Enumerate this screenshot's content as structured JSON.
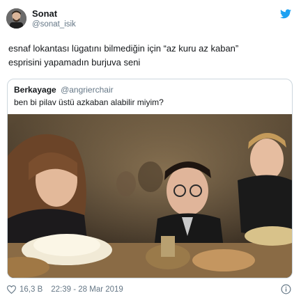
{
  "tweet": {
    "author_name": "Sonat",
    "author_handle": "@sonat_isik",
    "text_line1": "esnaf lokantası lügatını bilmediğin için “az kuru az kaban”",
    "text_line2": "esprisini yapamadın burjuva seni"
  },
  "quoted": {
    "author_name": "Berkayage",
    "author_handle": "@angrierchair",
    "text": "ben bi pilav üstü azkaban alabilir miyim?"
  },
  "footer": {
    "likes": "16,3 B",
    "timestamp": "22:39 - 28 Mar 2019"
  },
  "colors": {
    "twitter_blue": "#1da1f2",
    "secondary_text": "#657786",
    "border": "#ccd6dd"
  },
  "icons": {
    "brand": "twitter-bird-icon",
    "like": "heart-icon",
    "info": "info-icon"
  }
}
